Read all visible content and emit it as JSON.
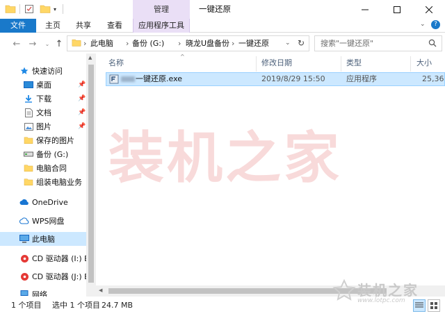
{
  "window": {
    "title": "一键还原",
    "context_tab": "管理",
    "minimize_icon": "minimize-icon",
    "maximize_icon": "maximize-icon",
    "close_icon": "close-icon"
  },
  "ribbon": {
    "tabs": [
      {
        "label": "文件"
      },
      {
        "label": "主页"
      },
      {
        "label": "共享"
      },
      {
        "label": "查看"
      },
      {
        "label": "应用程序工具"
      }
    ]
  },
  "address": {
    "crumbs": [
      "此电脑",
      "备份 (G:)",
      "晓龙U盘备份",
      "一键还原"
    ],
    "search_placeholder": "搜索\"一键还原\""
  },
  "nav": {
    "items": [
      {
        "label": "快速访问",
        "icon": "star-icon"
      },
      {
        "label": "桌面",
        "icon": "desktop-icon"
      },
      {
        "label": "下载",
        "icon": "download-icon"
      },
      {
        "label": "文档",
        "icon": "document-icon"
      },
      {
        "label": "图片",
        "icon": "picture-icon"
      },
      {
        "label": "保存的图片",
        "icon": "folder-icon"
      },
      {
        "label": "备份 (G:)",
        "icon": "drive-icon"
      },
      {
        "label": "电脑合同",
        "icon": "folder-icon"
      },
      {
        "label": "组装电脑业务",
        "icon": "folder-icon"
      },
      {
        "label": "OneDrive",
        "icon": "cloud-icon"
      },
      {
        "label": "WPS网盘",
        "icon": "cloud-icon"
      },
      {
        "label": "此电脑",
        "icon": "computer-icon"
      },
      {
        "label": "CD 驱动器 (I:) BC",
        "icon": "cd-drive-icon"
      },
      {
        "label": "CD 驱动器 (J:) BC",
        "icon": "cd-drive-icon"
      },
      {
        "label": "网络",
        "icon": "network-icon"
      }
    ]
  },
  "columns": [
    "名称",
    "修改日期",
    "类型",
    "大小"
  ],
  "files": [
    {
      "name": "一键还原.exe",
      "modified": "2019/8/29 15:50",
      "type": "应用程序",
      "size": "25,36"
    }
  ],
  "watermark": "装机之家",
  "status": {
    "count": "1 个项目",
    "selected": "选中 1 个项目",
    "size": "24.7 MB"
  },
  "logo": {
    "text": "装机之家",
    "url": "www.lotpc.com"
  },
  "colors": {
    "file_tab": "#1979ca",
    "context_tab": "#eadff6",
    "selection": "#cce8ff"
  }
}
